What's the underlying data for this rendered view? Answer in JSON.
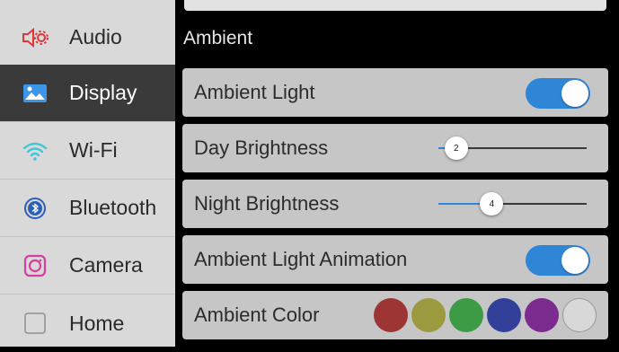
{
  "sidebar": {
    "items": [
      {
        "label": "Audio",
        "icon": "speaker-gear-icon"
      },
      {
        "label": "Display",
        "icon": "image-icon"
      },
      {
        "label": "Wi-Fi",
        "icon": "wifi-icon"
      },
      {
        "label": "Bluetooth",
        "icon": "bluetooth-icon"
      },
      {
        "label": "Camera",
        "icon": "camera-icon"
      },
      {
        "label": "Home",
        "icon": "home-square-icon"
      }
    ],
    "active": "Display"
  },
  "main": {
    "section_title": "Ambient",
    "rows": {
      "ambient_light": {
        "label": "Ambient Light",
        "enabled": true
      },
      "day_brightness": {
        "label": "Day Brightness",
        "value": "2",
        "fraction": 0.12
      },
      "night_brightness": {
        "label": "Night Brightness",
        "value": "4",
        "fraction": 0.36
      },
      "ambient_animation": {
        "label": "Ambient Light Animation",
        "enabled": true
      },
      "ambient_color": {
        "label": "Ambient Color",
        "swatches": [
          "#9e3535",
          "#9c9a3e",
          "#3e9b45",
          "#33409a",
          "#7b2b8e",
          "#d8d8d8"
        ]
      }
    }
  },
  "colors": {
    "accent": "#2f86d6",
    "sidebar_bg": "#d9d9d9",
    "sidebar_active_bg": "#3a3a3a",
    "row_bg": "#c6c6c6"
  }
}
